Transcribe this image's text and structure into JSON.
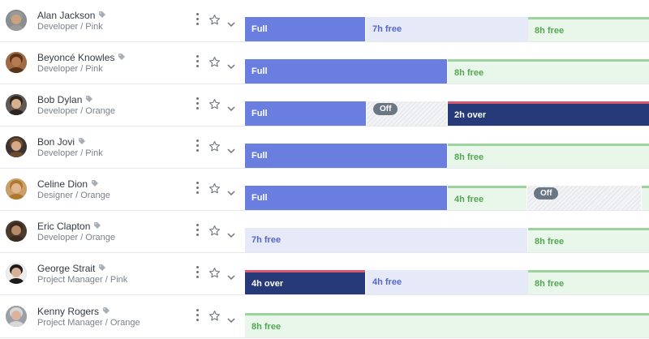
{
  "rows": [
    {
      "name": "Alan Jackson",
      "role": "Developer / Pink",
      "avatar": {
        "skin": "#c9a27e",
        "hair": "#9a9a9a",
        "bg": "#8b8e91"
      },
      "segments": [
        {
          "kind": "full",
          "label": "Full"
        },
        {
          "kind": "free",
          "label": "7h free"
        },
        {
          "kind": "fresh",
          "label": "8h free"
        }
      ]
    },
    {
      "name": "Beyoncé Knowles",
      "role": "Developer / Pink",
      "avatar": {
        "skin": "#b67a52",
        "hair": "#5a3418",
        "bg": "#a06a44"
      },
      "segments": [
        {
          "kind": "full",
          "label": "Full"
        },
        {
          "kind": "fresh",
          "label": "8h free"
        }
      ]
    },
    {
      "name": "Bob Dylan",
      "role": "Developer / Orange",
      "avatar": {
        "skin": "#d9b08c",
        "hair": "#2d2520",
        "bg": "#5f5a55"
      },
      "segments": [
        {
          "kind": "full",
          "label": "Full"
        },
        {
          "kind": "off",
          "label": "Off"
        },
        {
          "kind": "over",
          "label": "2h over"
        }
      ]
    },
    {
      "name": "Bon Jovi",
      "role": "Developer / Pink",
      "avatar": {
        "skin": "#d6a987",
        "hair": "#6b4a2e",
        "bg": "#3a3330"
      },
      "segments": [
        {
          "kind": "full",
          "label": "Full"
        },
        {
          "kind": "fresh",
          "label": "8h free"
        }
      ]
    },
    {
      "name": "Celine Dion",
      "role": "Designer / Orange",
      "avatar": {
        "skin": "#e2b690",
        "hair": "#b0772e",
        "bg": "#caa06a"
      },
      "segments": [
        {
          "kind": "full",
          "label": "Full"
        },
        {
          "kind": "fresh",
          "label": "4h free"
        },
        {
          "kind": "off",
          "label": "Off"
        },
        {
          "kind": "fresh",
          "label": ""
        }
      ]
    },
    {
      "name": "Eric Clapton",
      "role": "Developer / Orange",
      "avatar": {
        "skin": "#b98a66",
        "hair": "#3b2a1f",
        "bg": "#4a3b2f"
      },
      "segments": [
        {
          "kind": "free",
          "label": "7h free"
        },
        {
          "kind": "fresh",
          "label": "8h free"
        }
      ]
    },
    {
      "name": "George Strait",
      "role": "Project Manager / Pink",
      "avatar": {
        "skin": "#d8b195",
        "hair": "#1b1b1b",
        "bg": "#ececec"
      },
      "segments": [
        {
          "kind": "over",
          "label": "4h over"
        },
        {
          "kind": "free",
          "label": "4h free"
        },
        {
          "kind": "fresh",
          "label": "8h free"
        }
      ]
    },
    {
      "name": "Kenny Rogers",
      "role": "Project Manager / Orange",
      "avatar": {
        "skin": "#d9b3a0",
        "hair": "#d8d8d8",
        "bg": "#9aa0a6"
      },
      "segments": [
        {
          "kind": "fresh",
          "label": "8h free"
        }
      ]
    }
  ]
}
